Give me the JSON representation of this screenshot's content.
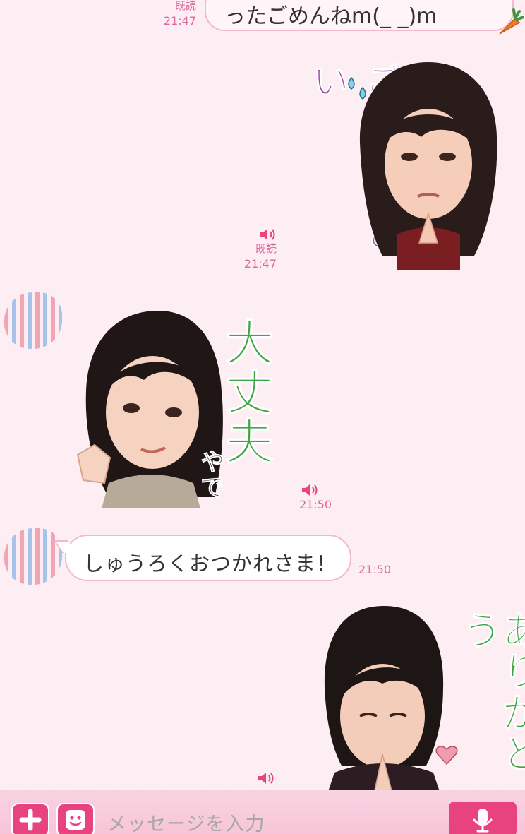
{
  "colors": {
    "background": "#fdeef4",
    "accent": "#e8437f",
    "meta": "#e0679a"
  },
  "messages": {
    "m1": {
      "text": "ったごめんねm(_ _)m",
      "read": "既読",
      "time": "21:47"
    },
    "m2": {
      "sticker_text": "ごめんなさい",
      "read": "既読",
      "time": "21:47"
    },
    "m3": {
      "sticker_text": "大丈夫",
      "sticker_subtext": "やで",
      "time": "21:50"
    },
    "m4": {
      "text": "しゅうろくおつかれさま！",
      "time": "21:50"
    },
    "m5": {
      "sticker_text": "ありがとう"
    }
  },
  "input": {
    "placeholder": "メッセージを入力"
  },
  "icons": [
    "speaker-icon",
    "carrot-icon",
    "plus-icon",
    "emoji-icon",
    "mic-icon",
    "heart-icon",
    "sweat-drop-icon"
  ]
}
